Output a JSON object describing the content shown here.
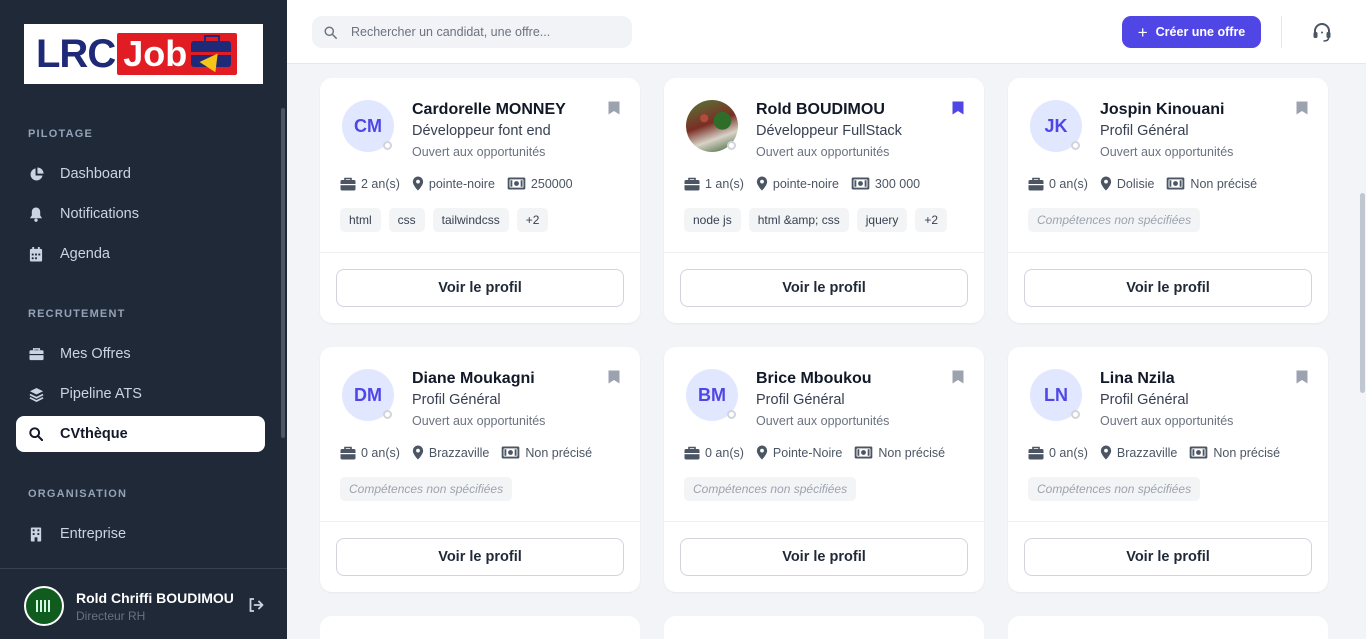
{
  "brand": {
    "part1": "LRC",
    "part2": "Job"
  },
  "sidebar": {
    "sections": [
      {
        "title": "PILOTAGE",
        "items": [
          {
            "label": "Dashboard",
            "icon": "pie-chart-icon"
          },
          {
            "label": "Notifications",
            "icon": "bell-icon"
          },
          {
            "label": "Agenda",
            "icon": "calendar-icon"
          }
        ]
      },
      {
        "title": "RECRUTEMENT",
        "items": [
          {
            "label": "Mes Offres",
            "icon": "briefcase-icon"
          },
          {
            "label": "Pipeline ATS",
            "icon": "layers-icon"
          },
          {
            "label": "CVthèque",
            "icon": "search-icon",
            "active": true
          }
        ]
      },
      {
        "title": "ORGANISATION",
        "items": [
          {
            "label": "Entreprise",
            "icon": "building-icon"
          }
        ]
      }
    ],
    "user": {
      "name": "Rold Chriffi BOUDIMOU",
      "role": "Directeur RH"
    }
  },
  "topbar": {
    "search_placeholder": "Rechercher un candidat, une offre...",
    "create_label": "Créer une offre"
  },
  "accent_color": "#4f46e5",
  "candidates": [
    {
      "initials": "CM",
      "name": "Cardorelle MONNEY",
      "role": "Développeur font end",
      "status": "Ouvert aux opportunités",
      "experience": "2 an(s)",
      "location": "pointe-noire",
      "salary": "250000",
      "tags": [
        "html",
        "css",
        "tailwindcss",
        "+2"
      ],
      "bookmarked": false,
      "button": "Voir le profil"
    },
    {
      "initials": "",
      "name": "Rold BOUDIMOU",
      "role": "Développeur FullStack",
      "status": "Ouvert aux opportunités",
      "experience": "1 an(s)",
      "location": "pointe-noire",
      "salary": "300 000",
      "tags": [
        "node js",
        "html &amp; css",
        "jquery",
        "+2"
      ],
      "bookmarked": true,
      "photo": true,
      "button": "Voir le profil"
    },
    {
      "initials": "JK",
      "name": "Jospin Kinouani",
      "role": "Profil Général",
      "status": "Ouvert aux opportunités",
      "experience": "0 an(s)",
      "location": "Dolisie",
      "salary": "Non précisé",
      "tags_empty": "Compétences non spécifiées",
      "bookmarked": false,
      "button": "Voir le profil"
    },
    {
      "initials": "DM",
      "name": "Diane Moukagni",
      "role": "Profil Général",
      "status": "Ouvert aux opportunités",
      "experience": "0 an(s)",
      "location": "Brazzaville",
      "salary": "Non précisé",
      "tags_empty": "Compétences non spécifiées",
      "bookmarked": false,
      "button": "Voir le profil"
    },
    {
      "initials": "BM",
      "name": "Brice Mboukou",
      "role": "Profil Général",
      "status": "Ouvert aux opportunités",
      "experience": "0 an(s)",
      "location": "Pointe-Noire",
      "salary": "Non précisé",
      "tags_empty": "Compétences non spécifiées",
      "bookmarked": false,
      "button": "Voir le profil"
    },
    {
      "initials": "LN",
      "name": "Lina Nzila",
      "role": "Profil Général",
      "status": "Ouvert aux opportunités",
      "experience": "0 an(s)",
      "location": "Brazzaville",
      "salary": "Non précisé",
      "tags_empty": "Compétences non spécifiées",
      "bookmarked": false,
      "button": "Voir le profil"
    }
  ]
}
